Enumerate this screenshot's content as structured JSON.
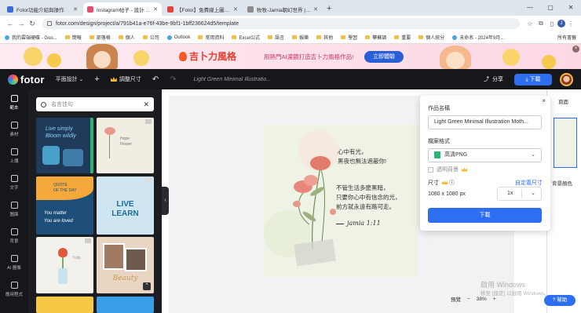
{
  "browser": {
    "tabs": [
      {
        "label": "Fotor功能介紹與操作",
        "color": "#3b6fd6"
      },
      {
        "label": "Instagram帖子 - 設計 | Fotor",
        "color": "#e94c6f",
        "active": true
      },
      {
        "label": "【Fotor】免費線上圖片編輯",
        "color": "#e0463c"
      },
      {
        "label": "牧牧-Jamia朝幻世界 | @jamia",
        "color": "#8b8b8b"
      }
    ],
    "new_tab": "+",
    "window_controls": [
      "—",
      "▢",
      "✕"
    ],
    "url": "fotor.com/design/project/a/791b41a-e76f-43be-9bf1-1bff236624d5/template",
    "bookmarks": [
      "我的雲端硬碟 - Goo...",
      "簡報",
      "部落格",
      "個人",
      "公司",
      "Outlook",
      "常用資料",
      "Excel公式",
      "語言",
      "娛樂",
      "其他",
      "學習",
      "攀蘇調",
      "重要",
      "個人統分",
      "未命名 - 2024年9月..."
    ],
    "all_bookmarks": "所有書籤"
  },
  "banner": {
    "brand": "吉卜力風格",
    "subtitle": "用熱門AI濾鏡打造吉卜力風格作品!",
    "cta": "立即體驗",
    "close": "×"
  },
  "editor": {
    "logo": "fotor",
    "mode": "平面設計",
    "resize": "調整尺寸",
    "filename": "Light Green Minimal Illustratio...",
    "share": "分享",
    "download": "下載",
    "rail": [
      "範本",
      "素材",
      "上傳",
      "文字",
      "圖庫",
      "背景",
      "AI 圖像",
      "應用程式"
    ]
  },
  "panel": {
    "search_placeholder": "名言佳句",
    "templates": [
      {
        "lines": [
          "Live simply",
          "Bloom wildly"
        ],
        "bg": "#1f3a5a"
      },
      {
        "lines": [
          "Hope",
          "Flower"
        ],
        "bg": "#f1ede3"
      },
      {
        "lines": [
          "QUOTE",
          "OF THE DAY",
          "You matter",
          "You are loved"
        ],
        "bg": "#1e4f7a"
      },
      {
        "lines": [
          "LIVE",
          "LEARN"
        ],
        "bg": "#cfe6f2"
      },
      {
        "lines": [
          "Tulip"
        ],
        "bg": "#f3f1ec"
      },
      {
        "lines": [
          "Beauty"
        ],
        "bg": "#e8d5c2"
      }
    ]
  },
  "canvas": {
    "art_line1": "心中有光，\n黑夜也無法遮蔽你!",
    "art_line2": "不管生活多麼黑暗，\n只要你心中有信念的光，\n前方就永遠有路可走。",
    "signature": "jamia 1:11"
  },
  "right_panel": {
    "header": "頁面",
    "background": "背景顏色"
  },
  "zoom": {
    "preview": "預覽",
    "level": "38%"
  },
  "help": "幫助",
  "watermark": {
    "line1": "啟用 Windows",
    "line2": "移至 [設定] 以啟用 Windows。"
  },
  "download_dialog": {
    "name_label": "作品名稱",
    "name_value": "Light Green Minimal Illustration Moth...",
    "format_label": "檔案格式",
    "format_value": "高清PNG",
    "transparent": "透明背景",
    "size_label": "尺寸",
    "custom_size": "自定義尺寸",
    "dims": "1080 x 1080 px",
    "scale": "1x",
    "submit": "下載",
    "close": "×"
  }
}
